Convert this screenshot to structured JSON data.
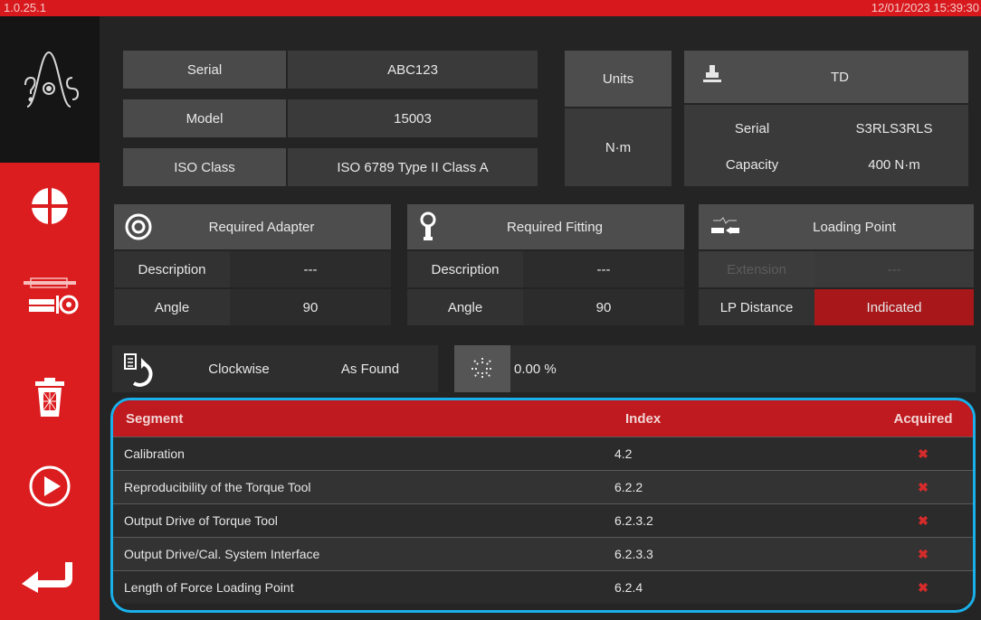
{
  "topbar": {
    "version": "1.0.25.1",
    "datetime": "12/01/2023 15:39:30"
  },
  "sidebar": {
    "items": [
      {
        "icon": "crosshair-icon"
      },
      {
        "icon": "connect-tool-icon"
      },
      {
        "icon": "trash-icon"
      },
      {
        "icon": "play-icon"
      },
      {
        "icon": "back-icon"
      }
    ]
  },
  "info": {
    "serial_label": "Serial",
    "serial_value": "ABC123",
    "model_label": "Model",
    "model_value": "15003",
    "iso_label": "ISO Class",
    "iso_value": "ISO 6789 Type II Class A"
  },
  "units": {
    "label": "Units",
    "value": "N·m"
  },
  "transducer": {
    "name": "TD",
    "serial_label": "Serial",
    "serial_value": "S3RLS3RLS",
    "capacity_label": "Capacity",
    "capacity_value": "400 N·m"
  },
  "adapter": {
    "title": "Required Adapter",
    "desc_label": "Description",
    "desc_value": "---",
    "angle_label": "Angle",
    "angle_value": "90"
  },
  "fitting": {
    "title": "Required Fitting",
    "desc_label": "Description",
    "desc_value": "---",
    "angle_label": "Angle",
    "angle_value": "90"
  },
  "loading": {
    "title": "Loading Point",
    "ext_label": "Extension",
    "ext_value": "---",
    "lp_label": "LP Distance",
    "lp_value": "Indicated"
  },
  "direction": {
    "label": "Clockwise",
    "mode": "As Found"
  },
  "progress": {
    "text": "0.00 %",
    "value": 0
  },
  "table": {
    "headers": [
      "Segment",
      "Index",
      "Acquired"
    ],
    "rows": [
      {
        "segment": "Calibration",
        "index": "4.2",
        "acquired": "✖"
      },
      {
        "segment": "Reproducibility of the Torque Tool",
        "index": "6.2.2",
        "acquired": "✖"
      },
      {
        "segment": "Output Drive of Torque Tool",
        "index": "6.2.3.2",
        "acquired": "✖"
      },
      {
        "segment": "Output Drive/Cal. System Interface",
        "index": "6.2.3.3",
        "acquired": "✖"
      },
      {
        "segment": "Length of Force Loading Point",
        "index": "6.2.4",
        "acquired": "✖"
      }
    ]
  },
  "colors": {
    "accent": "#d7191d",
    "highlight": "#1ab0ea",
    "bg": "#242424"
  }
}
